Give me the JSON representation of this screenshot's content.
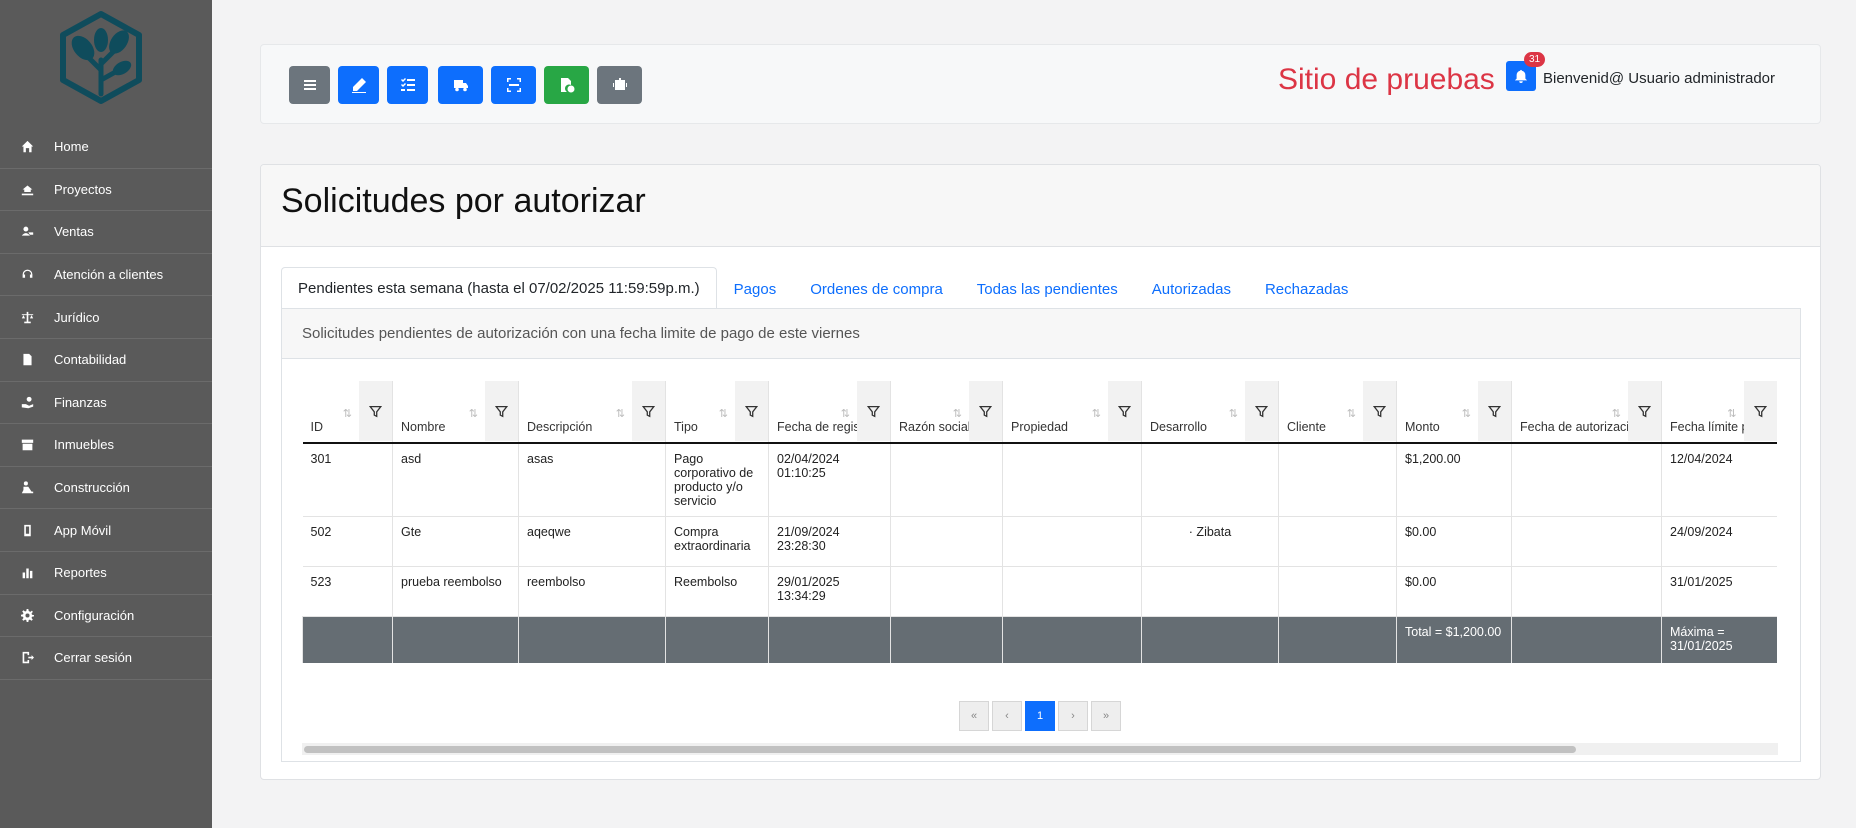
{
  "sidebar": {
    "items": [
      {
        "label": "Home",
        "icon": "home-icon"
      },
      {
        "label": "Proyectos",
        "icon": "hand-building-icon"
      },
      {
        "label": "Ventas",
        "icon": "handshake-icon"
      },
      {
        "label": "Atención a clientes",
        "icon": "headset-icon"
      },
      {
        "label": "Jurídico",
        "icon": "scale-icon"
      },
      {
        "label": "Contabilidad",
        "icon": "invoice-icon"
      },
      {
        "label": "Finanzas",
        "icon": "hand-coin-icon"
      },
      {
        "label": "Inmuebles",
        "icon": "store-icon"
      },
      {
        "label": "Construcción",
        "icon": "worker-icon"
      },
      {
        "label": "App Móvil",
        "icon": "mobile-icon"
      },
      {
        "label": "Reportes",
        "icon": "bar-chart-icon"
      },
      {
        "label": "Configuración",
        "icon": "gear-icon"
      },
      {
        "label": "Cerrar sesión",
        "icon": "logout-icon"
      }
    ]
  },
  "header": {
    "site_title": "Sitio de pruebas",
    "notification_count": "31",
    "welcome": "Bienvenid@ Usuario administrador",
    "toolbar": [
      {
        "icon": "menu-icon",
        "color": "#6c757d"
      },
      {
        "icon": "edit-icon",
        "color": "#0d6efd"
      },
      {
        "icon": "checklist-icon",
        "color": "#0d6efd"
      },
      {
        "icon": "truck-icon",
        "color": "#0d6efd"
      },
      {
        "icon": "scan-icon",
        "color": "#0d6efd"
      },
      {
        "icon": "file-check-icon",
        "color": "#28a745"
      },
      {
        "icon": "robot-icon",
        "color": "#6c757d"
      }
    ]
  },
  "page": {
    "title": "Solicitudes por autorizar",
    "tabs": [
      {
        "label": "Pendientes esta semana (hasta el 07/02/2025 11:59:59p.m.)",
        "active": true
      },
      {
        "label": "Pagos",
        "active": false
      },
      {
        "label": "Ordenes de compra",
        "active": false
      },
      {
        "label": "Todas las pendientes",
        "active": false
      },
      {
        "label": "Autorizadas",
        "active": false
      },
      {
        "label": "Rechazadas",
        "active": false
      }
    ],
    "description": "Solicitudes pendientes de autorización con una fecha limite de pago de este viernes"
  },
  "table": {
    "columns": [
      "ID",
      "Nombre",
      "Descripción",
      "Tipo",
      "Fecha de registro",
      "Razón social",
      "Propiedad",
      "Desarrollo",
      "Cliente",
      "Monto",
      "Fecha de autorización",
      "Fecha límite pago"
    ],
    "rows": [
      [
        "301",
        "asd",
        "asas",
        "Pago corporativo de producto y/o servicio",
        "02/04/2024 01:10:25",
        "",
        "",
        "",
        "",
        "$1,200.00",
        "",
        "12/04/2024"
      ],
      [
        "502",
        "Gte",
        "aqeqwe",
        "Compra extraordinaria",
        "21/09/2024 23:28:30",
        "",
        "",
        "· Zibata",
        "",
        "$0.00",
        "",
        "24/09/2024"
      ],
      [
        "523",
        "prueba reembolso",
        "reembolso",
        "Reembolso",
        "29/01/2025 13:34:29",
        "",
        "",
        "",
        "",
        "$0.00",
        "",
        "31/01/2025"
      ]
    ],
    "footer": {
      "total": "Total = $1,200.00",
      "max_date": "Máxima = 31/01/2025"
    }
  },
  "pagination": {
    "first": "«",
    "prev": "‹",
    "current": "1",
    "next": "›",
    "last": "»"
  }
}
